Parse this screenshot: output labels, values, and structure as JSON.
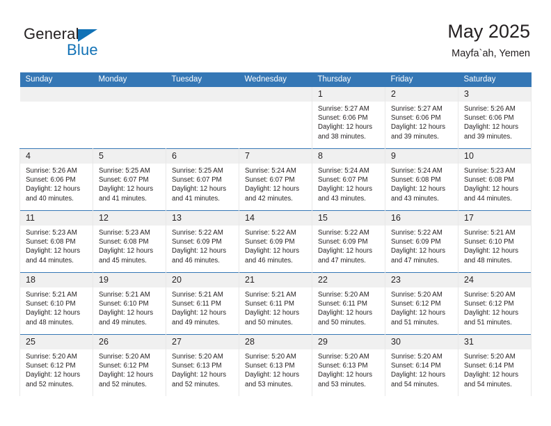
{
  "brand": {
    "word1": "General",
    "word2": "Blue",
    "triangle_color": "#1272b6",
    "text_color": "#231f20"
  },
  "header": {
    "title": "May 2025",
    "subtitle": "Mayfa`ah, Yemen",
    "accent_color": "#3577b5"
  },
  "calendar": {
    "weekday_headers": [
      "Sunday",
      "Monday",
      "Tuesday",
      "Wednesday",
      "Thursday",
      "Friday",
      "Saturday"
    ],
    "header_bg": "#3577b5",
    "daynum_bg": "#f0f0f0",
    "weeks": [
      [
        {
          "day": "",
          "lines": []
        },
        {
          "day": "",
          "lines": []
        },
        {
          "day": "",
          "lines": []
        },
        {
          "day": "",
          "lines": []
        },
        {
          "day": "1",
          "lines": [
            "Sunrise: 5:27 AM",
            "Sunset: 6:06 PM",
            "Daylight: 12 hours",
            "and 38 minutes."
          ]
        },
        {
          "day": "2",
          "lines": [
            "Sunrise: 5:27 AM",
            "Sunset: 6:06 PM",
            "Daylight: 12 hours",
            "and 39 minutes."
          ]
        },
        {
          "day": "3",
          "lines": [
            "Sunrise: 5:26 AM",
            "Sunset: 6:06 PM",
            "Daylight: 12 hours",
            "and 39 minutes."
          ]
        }
      ],
      [
        {
          "day": "4",
          "lines": [
            "Sunrise: 5:26 AM",
            "Sunset: 6:06 PM",
            "Daylight: 12 hours",
            "and 40 minutes."
          ]
        },
        {
          "day": "5",
          "lines": [
            "Sunrise: 5:25 AM",
            "Sunset: 6:07 PM",
            "Daylight: 12 hours",
            "and 41 minutes."
          ]
        },
        {
          "day": "6",
          "lines": [
            "Sunrise: 5:25 AM",
            "Sunset: 6:07 PM",
            "Daylight: 12 hours",
            "and 41 minutes."
          ]
        },
        {
          "day": "7",
          "lines": [
            "Sunrise: 5:24 AM",
            "Sunset: 6:07 PM",
            "Daylight: 12 hours",
            "and 42 minutes."
          ]
        },
        {
          "day": "8",
          "lines": [
            "Sunrise: 5:24 AM",
            "Sunset: 6:07 PM",
            "Daylight: 12 hours",
            "and 43 minutes."
          ]
        },
        {
          "day": "9",
          "lines": [
            "Sunrise: 5:24 AM",
            "Sunset: 6:08 PM",
            "Daylight: 12 hours",
            "and 43 minutes."
          ]
        },
        {
          "day": "10",
          "lines": [
            "Sunrise: 5:23 AM",
            "Sunset: 6:08 PM",
            "Daylight: 12 hours",
            "and 44 minutes."
          ]
        }
      ],
      [
        {
          "day": "11",
          "lines": [
            "Sunrise: 5:23 AM",
            "Sunset: 6:08 PM",
            "Daylight: 12 hours",
            "and 44 minutes."
          ]
        },
        {
          "day": "12",
          "lines": [
            "Sunrise: 5:23 AM",
            "Sunset: 6:08 PM",
            "Daylight: 12 hours",
            "and 45 minutes."
          ]
        },
        {
          "day": "13",
          "lines": [
            "Sunrise: 5:22 AM",
            "Sunset: 6:09 PM",
            "Daylight: 12 hours",
            "and 46 minutes."
          ]
        },
        {
          "day": "14",
          "lines": [
            "Sunrise: 5:22 AM",
            "Sunset: 6:09 PM",
            "Daylight: 12 hours",
            "and 46 minutes."
          ]
        },
        {
          "day": "15",
          "lines": [
            "Sunrise: 5:22 AM",
            "Sunset: 6:09 PM",
            "Daylight: 12 hours",
            "and 47 minutes."
          ]
        },
        {
          "day": "16",
          "lines": [
            "Sunrise: 5:22 AM",
            "Sunset: 6:09 PM",
            "Daylight: 12 hours",
            "and 47 minutes."
          ]
        },
        {
          "day": "17",
          "lines": [
            "Sunrise: 5:21 AM",
            "Sunset: 6:10 PM",
            "Daylight: 12 hours",
            "and 48 minutes."
          ]
        }
      ],
      [
        {
          "day": "18",
          "lines": [
            "Sunrise: 5:21 AM",
            "Sunset: 6:10 PM",
            "Daylight: 12 hours",
            "and 48 minutes."
          ]
        },
        {
          "day": "19",
          "lines": [
            "Sunrise: 5:21 AM",
            "Sunset: 6:10 PM",
            "Daylight: 12 hours",
            "and 49 minutes."
          ]
        },
        {
          "day": "20",
          "lines": [
            "Sunrise: 5:21 AM",
            "Sunset: 6:11 PM",
            "Daylight: 12 hours",
            "and 49 minutes."
          ]
        },
        {
          "day": "21",
          "lines": [
            "Sunrise: 5:21 AM",
            "Sunset: 6:11 PM",
            "Daylight: 12 hours",
            "and 50 minutes."
          ]
        },
        {
          "day": "22",
          "lines": [
            "Sunrise: 5:20 AM",
            "Sunset: 6:11 PM",
            "Daylight: 12 hours",
            "and 50 minutes."
          ]
        },
        {
          "day": "23",
          "lines": [
            "Sunrise: 5:20 AM",
            "Sunset: 6:12 PM",
            "Daylight: 12 hours",
            "and 51 minutes."
          ]
        },
        {
          "day": "24",
          "lines": [
            "Sunrise: 5:20 AM",
            "Sunset: 6:12 PM",
            "Daylight: 12 hours",
            "and 51 minutes."
          ]
        }
      ],
      [
        {
          "day": "25",
          "lines": [
            "Sunrise: 5:20 AM",
            "Sunset: 6:12 PM",
            "Daylight: 12 hours",
            "and 52 minutes."
          ]
        },
        {
          "day": "26",
          "lines": [
            "Sunrise: 5:20 AM",
            "Sunset: 6:12 PM",
            "Daylight: 12 hours",
            "and 52 minutes."
          ]
        },
        {
          "day": "27",
          "lines": [
            "Sunrise: 5:20 AM",
            "Sunset: 6:13 PM",
            "Daylight: 12 hours",
            "and 52 minutes."
          ]
        },
        {
          "day": "28",
          "lines": [
            "Sunrise: 5:20 AM",
            "Sunset: 6:13 PM",
            "Daylight: 12 hours",
            "and 53 minutes."
          ]
        },
        {
          "day": "29",
          "lines": [
            "Sunrise: 5:20 AM",
            "Sunset: 6:13 PM",
            "Daylight: 12 hours",
            "and 53 minutes."
          ]
        },
        {
          "day": "30",
          "lines": [
            "Sunrise: 5:20 AM",
            "Sunset: 6:14 PM",
            "Daylight: 12 hours",
            "and 54 minutes."
          ]
        },
        {
          "day": "31",
          "lines": [
            "Sunrise: 5:20 AM",
            "Sunset: 6:14 PM",
            "Daylight: 12 hours",
            "and 54 minutes."
          ]
        }
      ]
    ]
  }
}
